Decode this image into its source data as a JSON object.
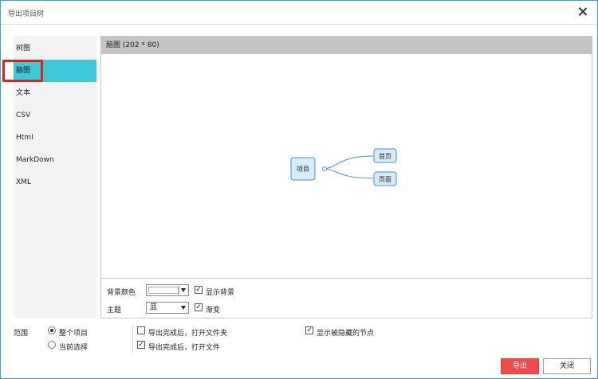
{
  "window": {
    "title": "导出项目树"
  },
  "sidebar": {
    "items": [
      {
        "label": "树图",
        "active": false
      },
      {
        "label": "脑图",
        "active": true
      },
      {
        "label": "文本",
        "active": false
      },
      {
        "label": "CSV",
        "active": false
      },
      {
        "label": "Html",
        "active": false
      },
      {
        "label": "MarkDown",
        "active": false
      },
      {
        "label": "XML",
        "active": false
      }
    ]
  },
  "preview": {
    "header": "脑图 (202 * 80)",
    "mindmap": {
      "root": "项目",
      "children": [
        "首页",
        "页面"
      ]
    }
  },
  "options": {
    "bg_color_label": "背景颜色",
    "bg_color_value": "#ffffff",
    "show_bg_label": "显示背景",
    "show_bg_checked": true,
    "theme_label": "主题",
    "theme_value": "蓝",
    "gradient_label": "渐变",
    "gradient_checked": true
  },
  "footer": {
    "scope_label": "范围",
    "scope_options": [
      {
        "label": "整个项目",
        "checked": true
      },
      {
        "label": "当前选择",
        "checked": false
      }
    ],
    "open_folder_label": "导出完成后，打开文件夹",
    "open_folder_checked": false,
    "open_file_label": "导出完成后，打开文件",
    "open_file_checked": true,
    "show_hidden_label": "显示被隐藏的节点",
    "show_hidden_checked": true,
    "export_button": "导出",
    "close_button": "关闭"
  },
  "colors": {
    "accent": "#3ec8d8",
    "export_button": "#f04a4a",
    "node_fill": "#d6ecfb",
    "node_border": "#4a90c8"
  }
}
